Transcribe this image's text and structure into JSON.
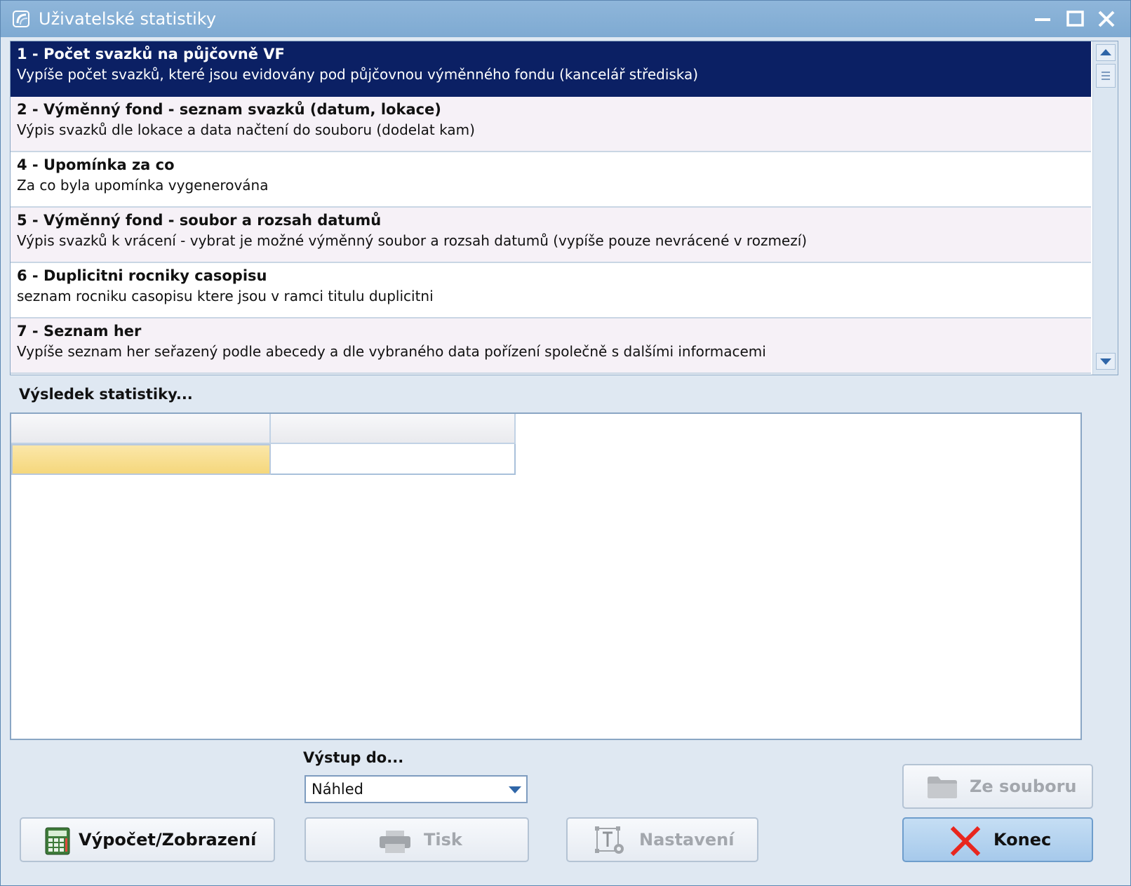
{
  "window": {
    "title": "Uživatelské statistiky"
  },
  "statistics_list": {
    "items": [
      {
        "title": "1 - Počet svazků na půjčovně VF",
        "description": "Vypíše počet svazků, které jsou evidovány pod půjčovnou výměnného fondu (kancelář střediska)",
        "selected": true
      },
      {
        "title": "2 - Výměnný fond - seznam svazků (datum, lokace)",
        "description": "Výpis svazků dle lokace a data načtení do souboru (dodelat kam)",
        "selected": false
      },
      {
        "title": "4 - Upomínka za co",
        "description": "Za co byla upomínka vygenerována",
        "selected": false
      },
      {
        "title": "5 - Výměnný fond - soubor a rozsah datumů",
        "description": "Výpis svazků k vrácení - vybrat je možné výměnný soubor a rozsah datumů (vypíše pouze nevrácené v rozmezí)",
        "selected": false
      },
      {
        "title": "6 - Duplicitni rocniky casopisu",
        "description": "seznam rocniku casopisu ktere jsou v ramci titulu duplicitni",
        "selected": false
      },
      {
        "title": "7 - Seznam her",
        "description": "Vypíše seznam her seřazený podle abecedy a dle vybraného data pořízení společně s dalšími informacemi",
        "selected": false
      }
    ]
  },
  "result": {
    "label": "Výsledek statistiky..."
  },
  "output": {
    "label": "Výstup do...",
    "selected_value": "Náhled"
  },
  "buttons": {
    "calculate": "Výpočet/Zobrazení",
    "print": "Tisk",
    "settings": "Nastavení",
    "from_file": "Ze souboru",
    "close": "Konec"
  },
  "colors": {
    "selection": "#0b2064",
    "titlebar": "#7eaad2",
    "close_icon": "#e8261e",
    "highlight_cell": "#f5d77c"
  }
}
